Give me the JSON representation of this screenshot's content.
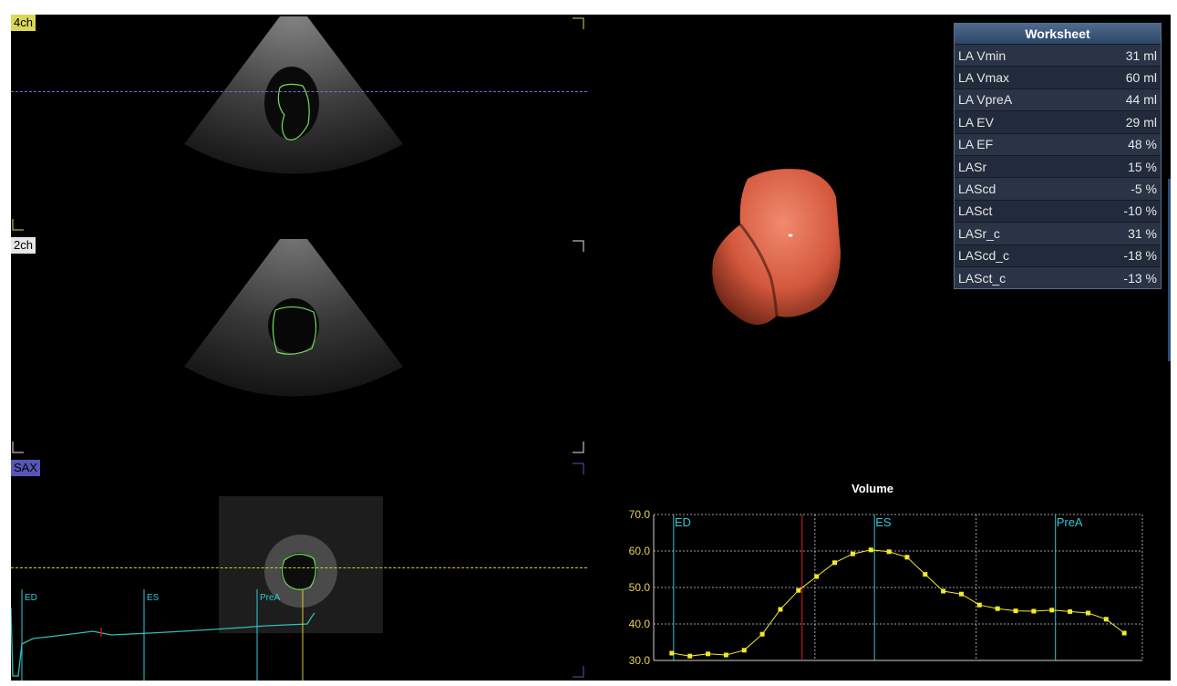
{
  "views": [
    {
      "label": "4ch",
      "label_bg": "#d9d75a",
      "crosshair_color": "#6e6ee0"
    },
    {
      "label": "2ch",
      "label_bg": "#e6e6e6",
      "crosshair_color": ""
    },
    {
      "label": "SAX",
      "label_bg": "#5656b8",
      "crosshair_color": "#d8cc3c"
    }
  ],
  "ecg_markers": [
    "ED",
    "ES",
    "PreA"
  ],
  "worksheet": {
    "title": "Worksheet",
    "rows": [
      {
        "name": "LA Vmin",
        "value": "31 ml"
      },
      {
        "name": "LA Vmax",
        "value": "60 ml"
      },
      {
        "name": "LA VpreA",
        "value": "44 ml"
      },
      {
        "name": "LA EV",
        "value": "29 ml"
      },
      {
        "name": "LA EF",
        "value": "48 %"
      },
      {
        "name": "LASr",
        "value": "15 %"
      },
      {
        "name": "LAScd",
        "value": "-5 %"
      },
      {
        "name": "LASct",
        "value": "-10 %"
      },
      {
        "name": "LASr_c",
        "value": "31 %"
      },
      {
        "name": "LAScd_c",
        "value": "-18 %"
      },
      {
        "name": "LASct_c",
        "value": "-13 %"
      }
    ]
  },
  "colors": {
    "contour": "#6fdc5a",
    "volume_curve": "#f2ea2a",
    "marker": "#35c7d6",
    "current_frame": "#c01818",
    "ecg": "#2fbfb5",
    "render": "#e2674b"
  },
  "chart_data": {
    "type": "line",
    "title": "Volume",
    "ylim": [
      30,
      70
    ],
    "yticks": [
      "70.0",
      "60.0",
      "50.0",
      "40.0",
      "30.0"
    ],
    "x": [
      1,
      2,
      3,
      4,
      5,
      6,
      7,
      8,
      9,
      10,
      11,
      12,
      13,
      14,
      15,
      16,
      17,
      18,
      19,
      20,
      21,
      22,
      23,
      24,
      25
    ],
    "values": [
      32.0,
      31.2,
      31.8,
      31.5,
      32.8,
      37.2,
      44.0,
      49.2,
      53.0,
      56.8,
      59.2,
      60.3,
      59.8,
      58.3,
      53.6,
      49.0,
      48.2,
      45.2,
      44.2,
      43.6,
      43.5,
      43.8,
      43.4,
      43.0,
      41.3,
      37.5
    ],
    "markers": [
      {
        "label": "ED",
        "x": 1.1
      },
      {
        "label": "ES",
        "x": 12.2
      },
      {
        "label": "PreA",
        "x": 22.2
      }
    ],
    "current_frame_x": 8.2,
    "grid": true
  }
}
